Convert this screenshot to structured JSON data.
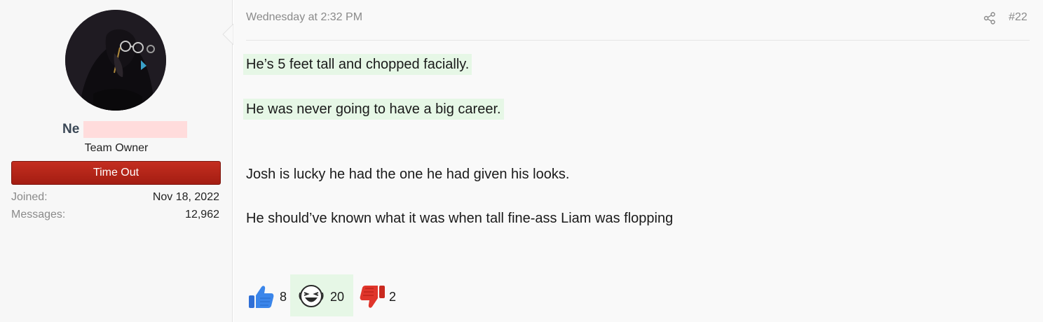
{
  "user": {
    "name_visible": "Ne",
    "title": "Team Owner",
    "banner": "Time Out",
    "stats": [
      {
        "label": "Joined:",
        "value": "Nov 18, 2022"
      },
      {
        "label": "Messages:",
        "value": "12,962"
      }
    ]
  },
  "post": {
    "date": "Wednesday at 2:32 PM",
    "number": "#22",
    "quote_lines": [
      "He’s 5 feet tall and chopped facially.",
      "He was never going to have a big career."
    ],
    "body_lines": [
      "Josh is lucky he had the one he had given his looks.",
      "He should’ve known what it was when tall fine-ass Liam was flopping"
    ]
  },
  "reactions": [
    {
      "icon": "thumbs-up-icon",
      "count": "8",
      "color": "#3b82e0"
    },
    {
      "icon": "laughing-face-icon",
      "count": "20",
      "color": "#2a2a2a"
    },
    {
      "icon": "thumbs-down-icon",
      "count": "2",
      "color": "#e0332a"
    }
  ],
  "colors": {
    "quote_highlight": "#e6f7e6",
    "banner_red": "#b3241a",
    "username": "#3b4856",
    "redaction": "#ffdcdc"
  }
}
